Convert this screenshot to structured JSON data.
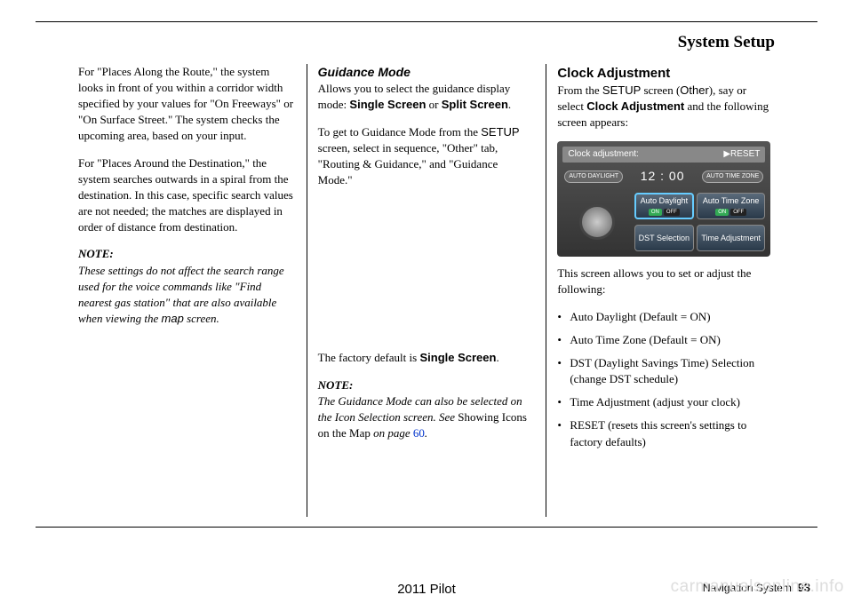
{
  "pageTitle": "System Setup",
  "col1": {
    "p1": "For \"Places Along the Route,\" the system looks in front of you within a corridor width specified by your values for \"On Freeways\" or \"On Surface Street.\" The system checks the upcoming area, based on your input.",
    "p2": "For \"Places Around the Destination,\" the system searches outwards in a spiral from the destination. In this case, specific search values are not needed; the matches are displayed in order of distance from destination.",
    "noteLabel": "NOTE:",
    "noteText1": "These settings do not affect the search range used for the voice commands like \"Find nearest gas station\" that are also available when viewing the ",
    "noteMap": "map",
    "noteText2": " screen."
  },
  "col2": {
    "heading": "Guidance Mode",
    "p1a": "Allows you to select the guidance display mode: ",
    "p1b": "Single Screen",
    "p1c": " or ",
    "p1d": "Split Screen",
    "p1e": ".",
    "p2a": "To get to Guidance Mode from the ",
    "p2b": "SETUP",
    "p2c": " screen, select in sequence, \"Other\" tab, \"Routing & Guidance,\" and \"Guidance Mode.\"",
    "p3a": "The factory default is ",
    "p3b": "Single Screen",
    "p3c": ".",
    "noteLabel": "NOTE:",
    "noteText1": "The Guidance Mode can also be selected on the Icon Selection screen. See ",
    "noteRef": "Showing Icons on the Map",
    "noteText2": " on page ",
    "noteLink": "60",
    "noteText3": "."
  },
  "col3": {
    "heading": "Clock Adjustment",
    "p1a": "From the ",
    "p1b": "SETUP",
    "p1c": " screen (",
    "p1d": "Other",
    "p1e": "), say or select ",
    "p1f": "Clock Adjustment",
    "p1g": " and the following screen appears:",
    "img": {
      "title": "Clock adjustment:",
      "reset": "▶RESET",
      "leftPill": "AUTO DAYLIGHT",
      "time": "12 : 00",
      "rightPill": "AUTO TIME ZONE",
      "btn1": "Auto Daylight",
      "btn2": "Auto Time Zone",
      "btn3": "DST Selection",
      "btn4": "Time Adjustment",
      "on": "ON",
      "off": "OFF"
    },
    "p2": "This screen allows you to set or adjust the following:",
    "bullets": [
      "Auto Daylight (Default = ON)",
      "Auto Time Zone (Default = ON)",
      "DST (Daylight Savings Time) Selection (change DST schedule)",
      "Time Adjustment (adjust your clock)",
      "RESET (resets this screen's settings to factory defaults)"
    ]
  },
  "footer": {
    "center": "2011 Pilot",
    "rightLabel": "Navigation System",
    "pageNum": "93"
  },
  "watermark": "carmanualsonline.info"
}
